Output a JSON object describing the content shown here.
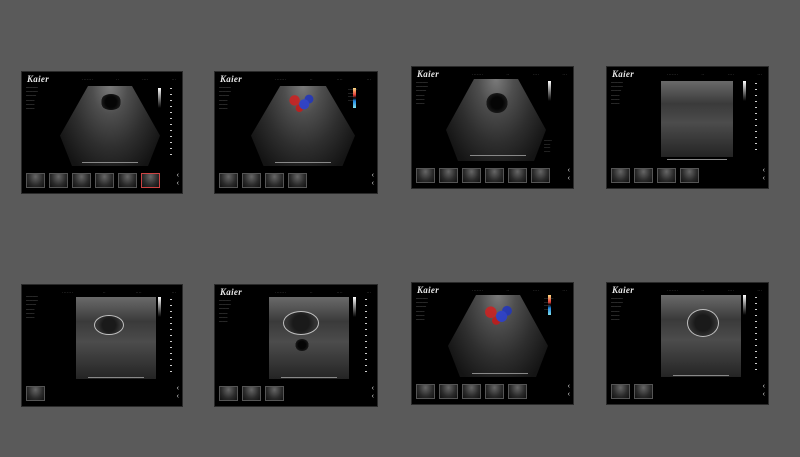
{
  "brand": "Kaier",
  "panels": [
    {
      "name": "panel-1",
      "mode": "bmode-fan",
      "thumbs": 6,
      "selected_thumb": 5
    },
    {
      "name": "panel-2",
      "mode": "color-doppler-fan",
      "thumbs": 4,
      "selected_thumb": -1
    },
    {
      "name": "panel-3",
      "mode": "bmode-fan-side",
      "thumbs": 6,
      "selected_thumb": -1
    },
    {
      "name": "panel-4",
      "mode": "mmode-rect",
      "thumbs": 4,
      "selected_thumb": -1
    },
    {
      "name": "panel-5",
      "mode": "bmode-rect-fetus",
      "thumbs": 1,
      "selected_thumb": -1
    },
    {
      "name": "panel-6",
      "mode": "bmode-rect-fetus",
      "thumbs": 3,
      "selected_thumb": -1
    },
    {
      "name": "panel-7",
      "mode": "color-doppler-fan",
      "thumbs": 5,
      "selected_thumb": -1
    },
    {
      "name": "panel-8",
      "mode": "bmode-rect-ring",
      "thumbs": 2,
      "selected_thumb": -1
    }
  ],
  "colors": {
    "background": "#5a5a5a",
    "screen": "#000000",
    "doppler_red": "#d12020",
    "doppler_blue": "#2a3fd6"
  }
}
